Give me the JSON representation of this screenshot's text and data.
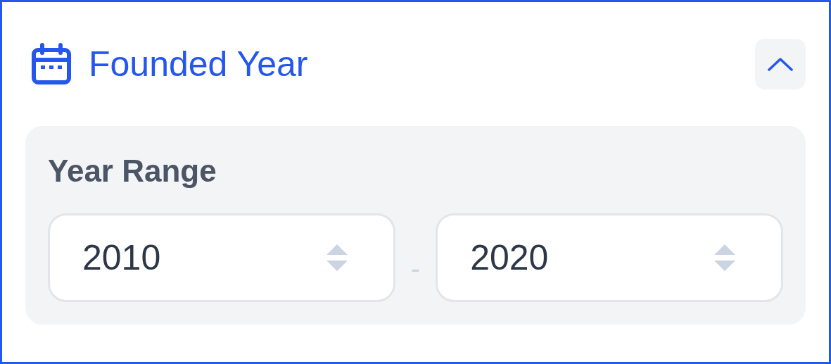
{
  "filter": {
    "title": "Founded Year",
    "expanded": true,
    "range": {
      "label": "Year Range",
      "separator": "-",
      "inputs": [
        {
          "value": "2010"
        },
        {
          "value": "2020"
        }
      ]
    }
  }
}
